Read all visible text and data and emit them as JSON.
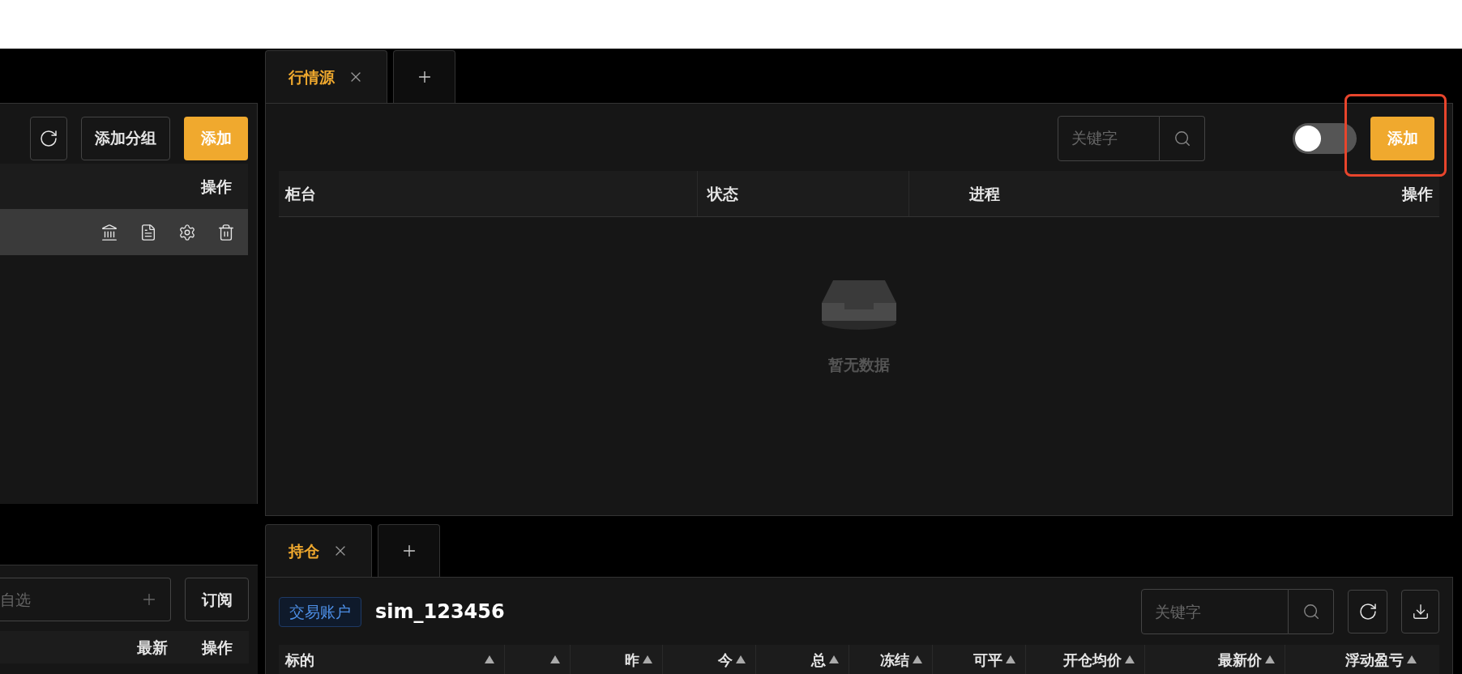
{
  "left_panel": {
    "toolbar": {
      "add_group_button": "添加分组",
      "add_button": "添加"
    },
    "columns": [
      "操作"
    ],
    "rows": [
      {
        "selected": true
      }
    ]
  },
  "watchlist_panel": {
    "search": {
      "placeholder": "自选"
    },
    "subscribe_button": "订阅",
    "columns": [
      "最新",
      "操作"
    ]
  },
  "market_panel": {
    "tabs": [
      {
        "label": "行情源",
        "selected": true
      }
    ],
    "search": {
      "placeholder": "关键字"
    },
    "toggle": {
      "on": false
    },
    "add_button": {
      "label": "添加",
      "highlighted": true
    },
    "columns": [
      "柜台",
      "状态",
      "进程",
      "操作"
    ],
    "empty_text": "暂无数据"
  },
  "positions_panel": {
    "tabs": [
      {
        "label": "持仓",
        "selected": true
      }
    ],
    "account_tag": "交易账户",
    "account": "sim_123456",
    "search": {
      "placeholder": "关键字"
    },
    "columns": [
      "标的",
      "",
      "昨",
      "今",
      "总",
      "冻结",
      "可平",
      "开仓均价",
      "最新价",
      "浮动盈亏"
    ]
  }
}
